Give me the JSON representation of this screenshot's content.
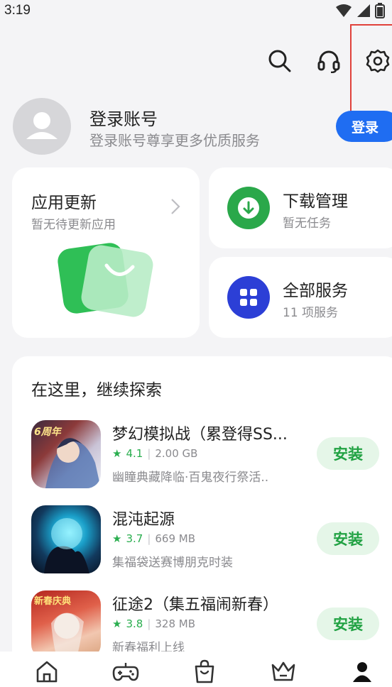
{
  "status": {
    "time": "3:19"
  },
  "account": {
    "title": "登录账号",
    "subtitle": "登录账号尊享更多优质服务",
    "login_label": "登录"
  },
  "cards": {
    "update": {
      "title": "应用更新",
      "subtitle": "暂无待更新应用"
    },
    "download": {
      "title": "下载管理",
      "subtitle": "暂无任务"
    },
    "services": {
      "title": "全部服务",
      "subtitle": "11 项服务"
    }
  },
  "explore": {
    "title": "在这里，继续探索",
    "apps": [
      {
        "name": "梦幻模拟战（累登得SS...",
        "rating": "4.1",
        "size": "2.00 GB",
        "desc": "幽瞳典藏降临·百鬼夜行祭活..",
        "install_label": "安装",
        "icon_badge": "6周年"
      },
      {
        "name": "混沌起源",
        "rating": "3.7",
        "size": "669 MB",
        "desc": "集福袋送赛博朋克时装",
        "install_label": "安装"
      },
      {
        "name": "征途2（集五福闹新春）",
        "rating": "3.8",
        "size": "328 MB",
        "desc": "新春福利上线",
        "install_label": "安装",
        "icon_badge": "新春庆典"
      }
    ]
  },
  "colors": {
    "accent_blue": "#1f6df2",
    "install_green": "#22a244",
    "download_green": "#2aa84a",
    "services_blue": "#2c3fd6",
    "highlight_red": "#e0413b"
  },
  "nav": {
    "items": [
      "home-icon",
      "game-controller-icon",
      "shopping-bag-icon",
      "crown-icon",
      "profile-icon"
    ]
  }
}
